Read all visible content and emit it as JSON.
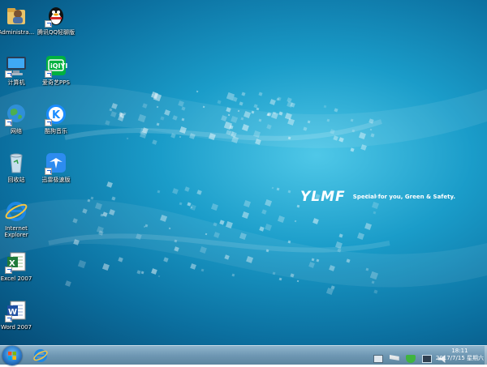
{
  "desktop": {
    "icons": [
      {
        "label": "Administra..."
      },
      {
        "label": "腾讯QQ轻聊版"
      },
      {
        "label": "计算机"
      },
      {
        "label": "爱奇艺PPS"
      },
      {
        "label": "网络"
      },
      {
        "label": "酷狗音乐"
      },
      {
        "label": "回收站"
      },
      {
        "label": "迅雷极速版"
      },
      {
        "label": "Internet Explorer"
      },
      {
        "label": "Excel 2007"
      },
      {
        "label": "Word 2007"
      }
    ],
    "wallpaper": {
      "brand": "YLMF",
      "tagline": "Special for you, Green & Safety."
    }
  },
  "taskbar": {
    "clock_time": "18:11",
    "clock_date": "2017/7/15 星期六"
  },
  "colors": {
    "wallpaper": "#1a9cc9",
    "taskbar": "#6f98b4"
  }
}
